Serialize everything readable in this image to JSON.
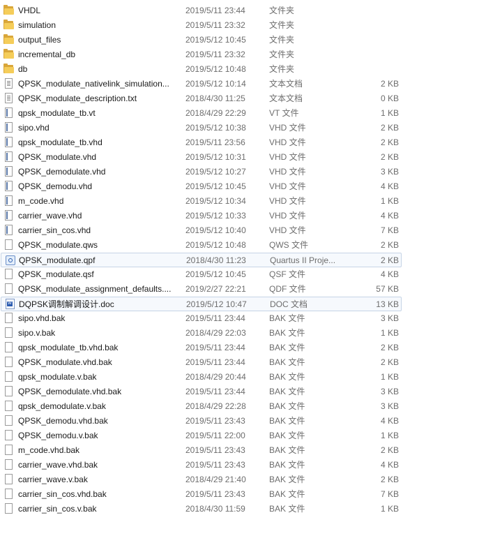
{
  "files": [
    {
      "name": "VHDL",
      "date": "2019/5/11 23:44",
      "type": "文件夹",
      "size": "",
      "icon": "folder-icon",
      "selected": false
    },
    {
      "name": "simulation",
      "date": "2019/5/11 23:32",
      "type": "文件夹",
      "size": "",
      "icon": "folder-icon",
      "selected": false
    },
    {
      "name": "output_files",
      "date": "2019/5/12 10:45",
      "type": "文件夹",
      "size": "",
      "icon": "folder-icon",
      "selected": false
    },
    {
      "name": "incremental_db",
      "date": "2019/5/11 23:32",
      "type": "文件夹",
      "size": "",
      "icon": "folder-icon",
      "selected": false
    },
    {
      "name": "db",
      "date": "2019/5/12 10:48",
      "type": "文件夹",
      "size": "",
      "icon": "folder-icon",
      "selected": false
    },
    {
      "name": "QPSK_modulate_nativelink_simulation...",
      "date": "2019/5/12 10:14",
      "type": "文本文档",
      "size": "2 KB",
      "icon": "text-file-icon",
      "selected": false
    },
    {
      "name": "QPSK_modulate_description.txt",
      "date": "2018/4/30 11:25",
      "type": "文本文档",
      "size": "0 KB",
      "icon": "text-file-icon",
      "selected": false
    },
    {
      "name": "qpsk_modulate_tb.vt",
      "date": "2018/4/29 22:29",
      "type": "VT 文件",
      "size": "1 KB",
      "icon": "code-file-icon",
      "selected": false
    },
    {
      "name": "sipo.vhd",
      "date": "2019/5/12 10:38",
      "type": "VHD 文件",
      "size": "2 KB",
      "icon": "code-file-icon",
      "selected": false
    },
    {
      "name": "qpsk_modulate_tb.vhd",
      "date": "2019/5/11 23:56",
      "type": "VHD 文件",
      "size": "2 KB",
      "icon": "code-file-icon",
      "selected": false
    },
    {
      "name": "QPSK_modulate.vhd",
      "date": "2019/5/12 10:31",
      "type": "VHD 文件",
      "size": "2 KB",
      "icon": "code-file-icon",
      "selected": false
    },
    {
      "name": "QPSK_demodulate.vhd",
      "date": "2019/5/12 10:27",
      "type": "VHD 文件",
      "size": "3 KB",
      "icon": "code-file-icon",
      "selected": false
    },
    {
      "name": "QPSK_demodu.vhd",
      "date": "2019/5/12 10:45",
      "type": "VHD 文件",
      "size": "4 KB",
      "icon": "code-file-icon",
      "selected": false
    },
    {
      "name": "m_code.vhd",
      "date": "2019/5/12 10:34",
      "type": "VHD 文件",
      "size": "1 KB",
      "icon": "code-file-icon",
      "selected": false
    },
    {
      "name": "carrier_wave.vhd",
      "date": "2019/5/12 10:33",
      "type": "VHD 文件",
      "size": "4 KB",
      "icon": "code-file-icon",
      "selected": false
    },
    {
      "name": "carrier_sin_cos.vhd",
      "date": "2019/5/12 10:40",
      "type": "VHD 文件",
      "size": "7 KB",
      "icon": "code-file-icon",
      "selected": false
    },
    {
      "name": "QPSK_modulate.qws",
      "date": "2019/5/12 10:48",
      "type": "QWS 文件",
      "size": "2 KB",
      "icon": "blank-file-icon",
      "selected": false
    },
    {
      "name": "QPSK_modulate.qpf",
      "date": "2018/4/30 11:23",
      "type": "Quartus II Proje...",
      "size": "2 KB",
      "icon": "quartus-project-icon",
      "selected": true
    },
    {
      "name": "QPSK_modulate.qsf",
      "date": "2019/5/12 10:45",
      "type": "QSF 文件",
      "size": "4 KB",
      "icon": "blank-file-icon",
      "selected": false
    },
    {
      "name": "QPSK_modulate_assignment_defaults....",
      "date": "2019/2/27 22:21",
      "type": "QDF 文件",
      "size": "57 KB",
      "icon": "blank-file-icon",
      "selected": false
    },
    {
      "name": "DQPSK调制解调设计.doc",
      "date": "2019/5/12 10:47",
      "type": "DOC 文档",
      "size": "13 KB",
      "icon": "word-doc-icon",
      "selected": true
    },
    {
      "name": "sipo.vhd.bak",
      "date": "2019/5/11 23:44",
      "type": "BAK 文件",
      "size": "3 KB",
      "icon": "blank-file-icon",
      "selected": false
    },
    {
      "name": "sipo.v.bak",
      "date": "2018/4/29 22:03",
      "type": "BAK 文件",
      "size": "1 KB",
      "icon": "blank-file-icon",
      "selected": false
    },
    {
      "name": "qpsk_modulate_tb.vhd.bak",
      "date": "2019/5/11 23:44",
      "type": "BAK 文件",
      "size": "2 KB",
      "icon": "blank-file-icon",
      "selected": false
    },
    {
      "name": "QPSK_modulate.vhd.bak",
      "date": "2019/5/11 23:44",
      "type": "BAK 文件",
      "size": "2 KB",
      "icon": "blank-file-icon",
      "selected": false
    },
    {
      "name": "qpsk_modulate.v.bak",
      "date": "2018/4/29 20:44",
      "type": "BAK 文件",
      "size": "1 KB",
      "icon": "blank-file-icon",
      "selected": false
    },
    {
      "name": "QPSK_demodulate.vhd.bak",
      "date": "2019/5/11 23:44",
      "type": "BAK 文件",
      "size": "3 KB",
      "icon": "blank-file-icon",
      "selected": false
    },
    {
      "name": "qpsk_demodulate.v.bak",
      "date": "2018/4/29 22:28",
      "type": "BAK 文件",
      "size": "3 KB",
      "icon": "blank-file-icon",
      "selected": false
    },
    {
      "name": "QPSK_demodu.vhd.bak",
      "date": "2019/5/11 23:43",
      "type": "BAK 文件",
      "size": "4 KB",
      "icon": "blank-file-icon",
      "selected": false
    },
    {
      "name": "QPSK_demodu.v.bak",
      "date": "2019/5/11 22:00",
      "type": "BAK 文件",
      "size": "1 KB",
      "icon": "blank-file-icon",
      "selected": false
    },
    {
      "name": "m_code.vhd.bak",
      "date": "2019/5/11 23:43",
      "type": "BAK 文件",
      "size": "2 KB",
      "icon": "blank-file-icon",
      "selected": false
    },
    {
      "name": "carrier_wave.vhd.bak",
      "date": "2019/5/11 23:43",
      "type": "BAK 文件",
      "size": "4 KB",
      "icon": "blank-file-icon",
      "selected": false
    },
    {
      "name": "carrier_wave.v.bak",
      "date": "2018/4/29 21:40",
      "type": "BAK 文件",
      "size": "2 KB",
      "icon": "blank-file-icon",
      "selected": false
    },
    {
      "name": "carrier_sin_cos.vhd.bak",
      "date": "2019/5/11 23:43",
      "type": "BAK 文件",
      "size": "7 KB",
      "icon": "blank-file-icon",
      "selected": false
    },
    {
      "name": "carrier_sin_cos.v.bak",
      "date": "2018/4/30 11:59",
      "type": "BAK 文件",
      "size": "1 KB",
      "icon": "blank-file-icon",
      "selected": false
    }
  ]
}
